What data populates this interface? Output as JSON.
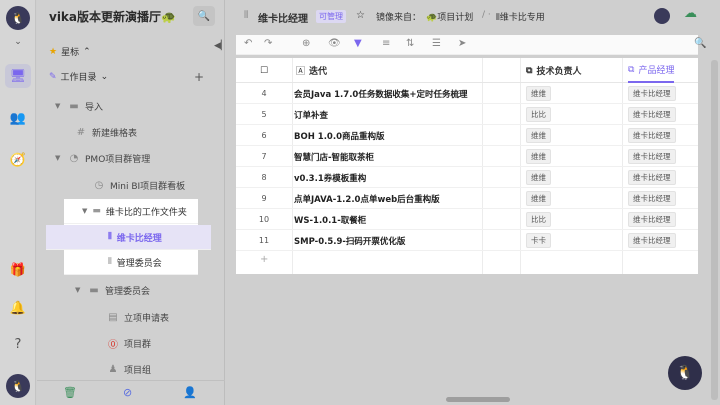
{
  "space": {
    "title": "vika版本更新演播厅🐢",
    "search_icon": "search-icon"
  },
  "rail": {
    "icons": [
      "home-icon",
      "desktop-icon",
      "users-icon",
      "compass-icon",
      "gift-icon",
      "bell-icon",
      "help-icon"
    ]
  },
  "sidebar": {
    "starred_label": "星标",
    "catalog_label": "工作目录",
    "tree": [
      {
        "label": "导入",
        "type": "folder"
      },
      {
        "label": "新建维格表",
        "type": "sheet"
      },
      {
        "label": "PMO项目群管理",
        "type": "folder"
      },
      {
        "label": "Mini BI项目群看板",
        "type": "dashboard"
      },
      {
        "label": "维卡比的工作文件夹",
        "type": "folder"
      },
      {
        "label": "维卡比经理",
        "type": "mirror",
        "selected": true
      },
      {
        "label": "管理委员会",
        "type": "mirror"
      },
      {
        "label": "管理委员会",
        "type": "folder"
      },
      {
        "label": "立项申请表",
        "type": "form"
      },
      {
        "label": "项目群",
        "type": "sheet"
      },
      {
        "label": "项目组",
        "type": "sheet"
      }
    ]
  },
  "topbar": {
    "title": "维卡比经理",
    "permission": "可管理",
    "mirror_from": "镜像来自：",
    "source_sheet": "项目计划",
    "source_view": "维卡比专用"
  },
  "table": {
    "columns": [
      "迭代",
      "技术负责人",
      "产品经理"
    ],
    "rows": [
      {
        "num": "4",
        "name": "会员Java 1.7.0任务数据收集+定时任务梳理",
        "tech": "维维",
        "pm": "维卡比经理"
      },
      {
        "num": "5",
        "name": "订单补查",
        "tech": "比比",
        "pm": "维卡比经理"
      },
      {
        "num": "6",
        "name": "BOH 1.0.0商品重构版",
        "tech": "维维",
        "pm": "维卡比经理"
      },
      {
        "num": "7",
        "name": "智慧门店-智能取茶柜",
        "tech": "维维",
        "pm": "维卡比经理"
      },
      {
        "num": "8",
        "name": "v0.3.1券模板重构",
        "tech": "维维",
        "pm": "维卡比经理"
      },
      {
        "num": "9",
        "name": "点单JAVA-1.2.0点单web后台重构版",
        "tech": "维维",
        "pm": "维卡比经理"
      },
      {
        "num": "10",
        "name": "WS-1.0.1-取餐柜",
        "tech": "比比",
        "pm": "维卡比经理"
      },
      {
        "num": "11",
        "name": "SMP-0.5.9-扫码开票优化版",
        "tech": "卡卡",
        "pm": "维卡比经理"
      }
    ],
    "add_symbol": "+"
  },
  "colors": {
    "accent": "#7b67ee"
  }
}
